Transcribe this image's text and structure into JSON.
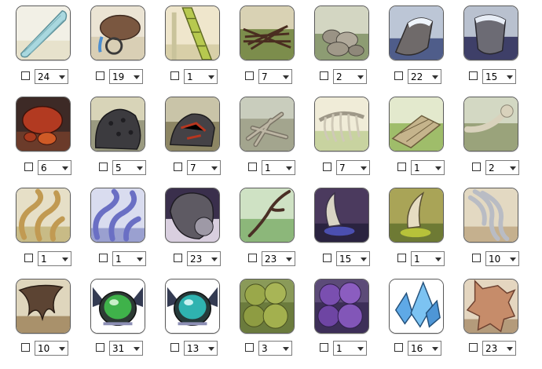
{
  "items": [
    {
      "qty": "24",
      "icon": "dragonfly-wing-icon"
    },
    {
      "qty": "19",
      "icon": "waterskin-icon"
    },
    {
      "qty": "1",
      "icon": "bamboo-stalk-icon"
    },
    {
      "qty": "7",
      "icon": "twig-bundle-icon"
    },
    {
      "qty": "2",
      "icon": "rock-pile-icon"
    },
    {
      "qty": "22",
      "icon": "icy-stone-icon"
    },
    {
      "qty": "15",
      "icon": "river-slate-icon"
    },
    {
      "qty": "6",
      "icon": "ember-rocks-icon"
    },
    {
      "qty": "5",
      "icon": "volcanic-rock-icon"
    },
    {
      "qty": "7",
      "icon": "magma-rock-pile-icon"
    },
    {
      "qty": "1",
      "icon": "bone-pile-icon"
    },
    {
      "qty": "7",
      "icon": "ribcage-icon"
    },
    {
      "qty": "1",
      "icon": "wooden-planks-icon"
    },
    {
      "qty": "2",
      "icon": "skull-bone-icon"
    },
    {
      "qty": "1",
      "icon": "tan-wisp-icon"
    },
    {
      "qty": "1",
      "icon": "indigo-wisp-icon"
    },
    {
      "qty": "23",
      "icon": "dark-meteorite-icon"
    },
    {
      "qty": "23",
      "icon": "forked-branch-icon"
    },
    {
      "qty": "15",
      "icon": "shadow-horn-icon"
    },
    {
      "qty": "1",
      "icon": "swamp-horn-icon"
    },
    {
      "qty": "10",
      "icon": "silver-wisp-icon"
    },
    {
      "qty": "10",
      "icon": "brown-fur-tuft-icon"
    },
    {
      "qty": "31",
      "icon": "green-scarab-icon"
    },
    {
      "qty": "13",
      "icon": "teal-scarab-icon"
    },
    {
      "qty": "3",
      "icon": "green-moss-icon"
    },
    {
      "qty": "1",
      "icon": "purple-moss-icon"
    },
    {
      "qty": "16",
      "icon": "blue-crystal-icon"
    },
    {
      "qty": "23",
      "icon": "hide-pelt-icon"
    }
  ]
}
